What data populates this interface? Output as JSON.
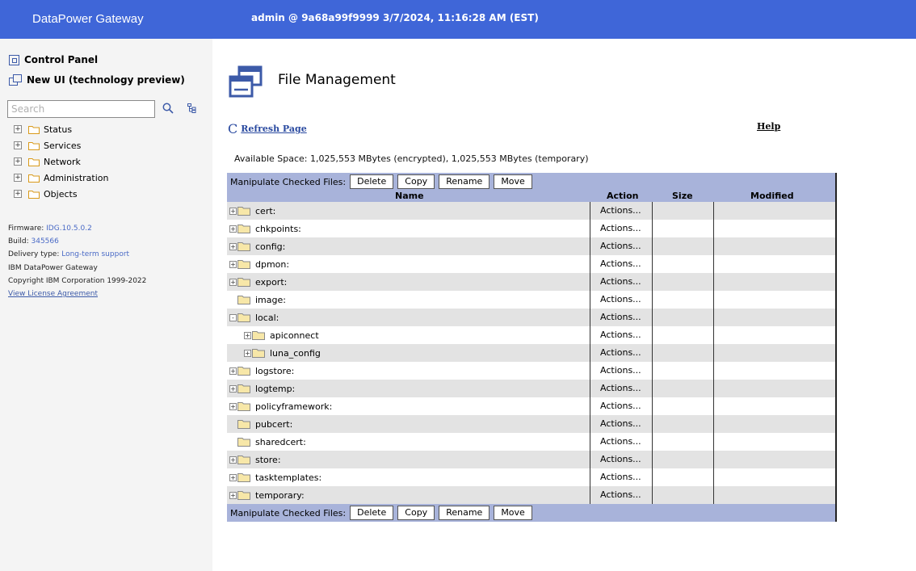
{
  "header": {
    "brand": "DataPower Gateway",
    "session": "admin @ 9a68a99f9999 3/7/2024, 11:16:28 AM (EST)"
  },
  "sidebar": {
    "control_panel": "Control Panel",
    "new_ui": "New UI (technology preview)",
    "search_placeholder": "Search",
    "nav": [
      {
        "label": "Status"
      },
      {
        "label": "Services"
      },
      {
        "label": "Network"
      },
      {
        "label": "Administration"
      },
      {
        "label": "Objects"
      }
    ],
    "firmware_label": "Firmware:",
    "firmware_value": "IDG.10.5.0.2",
    "build_label": "Build:",
    "build_value": "345566",
    "delivery_label": "Delivery type:",
    "delivery_value": "Long-term support",
    "product": "IBM DataPower Gateway",
    "copyright": "Copyright IBM Corporation 1999-2022",
    "license_link": "View License Agreement"
  },
  "main": {
    "title": "File Management",
    "refresh": "Refresh Page",
    "help": "Help",
    "available_space": "Available Space: 1,025,553 MBytes (encrypted), 1,025,553 MBytes (temporary)",
    "manipulate_label": "Manipulate Checked Files:",
    "buttons": [
      "Delete",
      "Copy",
      "Rename",
      "Move"
    ],
    "columns": {
      "name": "Name",
      "action": "Action",
      "size": "Size",
      "modified": "Modified"
    },
    "action_text": "Actions...",
    "rows": [
      {
        "name": "cert:",
        "toggle": "+",
        "level": 0
      },
      {
        "name": "chkpoints:",
        "toggle": "+",
        "level": 0
      },
      {
        "name": "config:",
        "toggle": "+",
        "level": 0
      },
      {
        "name": "dpmon:",
        "toggle": "+",
        "level": 0
      },
      {
        "name": "export:",
        "toggle": "+",
        "level": 0
      },
      {
        "name": "image:",
        "toggle": "",
        "level": 0
      },
      {
        "name": "local:",
        "toggle": "-",
        "level": 0
      },
      {
        "name": "apiconnect",
        "toggle": "+",
        "level": 1
      },
      {
        "name": "luna_config",
        "toggle": "+",
        "level": 1
      },
      {
        "name": "logstore:",
        "toggle": "+",
        "level": 0
      },
      {
        "name": "logtemp:",
        "toggle": "+",
        "level": 0
      },
      {
        "name": "policyframework:",
        "toggle": "+",
        "level": 0
      },
      {
        "name": "pubcert:",
        "toggle": "",
        "level": 0
      },
      {
        "name": "sharedcert:",
        "toggle": "",
        "level": 0
      },
      {
        "name": "store:",
        "toggle": "+",
        "level": 0
      },
      {
        "name": "tasktemplates:",
        "toggle": "+",
        "level": 0
      },
      {
        "name": "temporary:",
        "toggle": "+",
        "level": 0
      }
    ]
  },
  "colors": {
    "topbar": "#3f66d8",
    "sidebar": "#f4f4f4",
    "table_header": "#a8b3da",
    "row_alt": "#e3e3e3",
    "link": "#2a4aa0"
  }
}
